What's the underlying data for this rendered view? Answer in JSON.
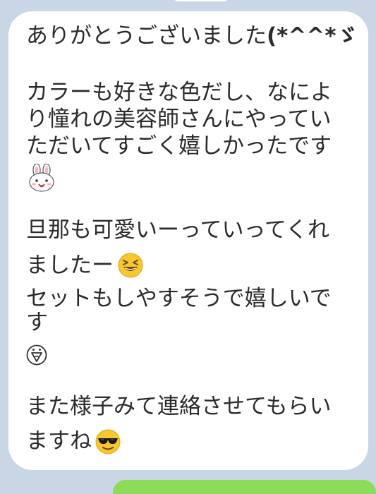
{
  "chat": {
    "message_lines": [
      "ありがとうございました",
      "(*^^*ゞ",
      "カラーも好きな色だし、なによ",
      "り憧れの美容師さんにやってい",
      "ただいてすごく嬉しかったです",
      "旦那も可愛いーっていってくれ",
      "ましたー",
      "セットもしやすそうで嬉しいで",
      "す",
      "また様子みて連絡させてもらい",
      "ますね"
    ],
    "emojis": {
      "bunny": "bunny-sticker-emoji",
      "grin": "grinning-squint-emoji",
      "face": "surprised-face-emoji",
      "sunglasses": "sunglasses-emoji"
    }
  },
  "colors": {
    "background": "#c9d6e6",
    "bubble": "#ffffff",
    "sent_bubble": "#8cdc5a",
    "text": "#2b2b2b"
  }
}
